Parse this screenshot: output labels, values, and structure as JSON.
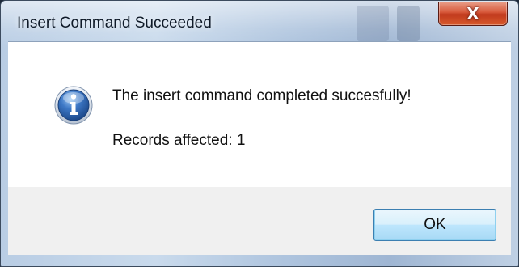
{
  "window": {
    "title": "Insert Command Succeeded",
    "close_glyph": "X"
  },
  "dialog": {
    "icon": "info-icon",
    "message": "The insert command completed succesfully!",
    "records": "Records affected: 1"
  },
  "buttons": {
    "ok_label": "OK"
  },
  "colors": {
    "close_button": "#c13a1d",
    "ok_border": "#3c7fb1",
    "info_icon": "#2b5ea8"
  }
}
